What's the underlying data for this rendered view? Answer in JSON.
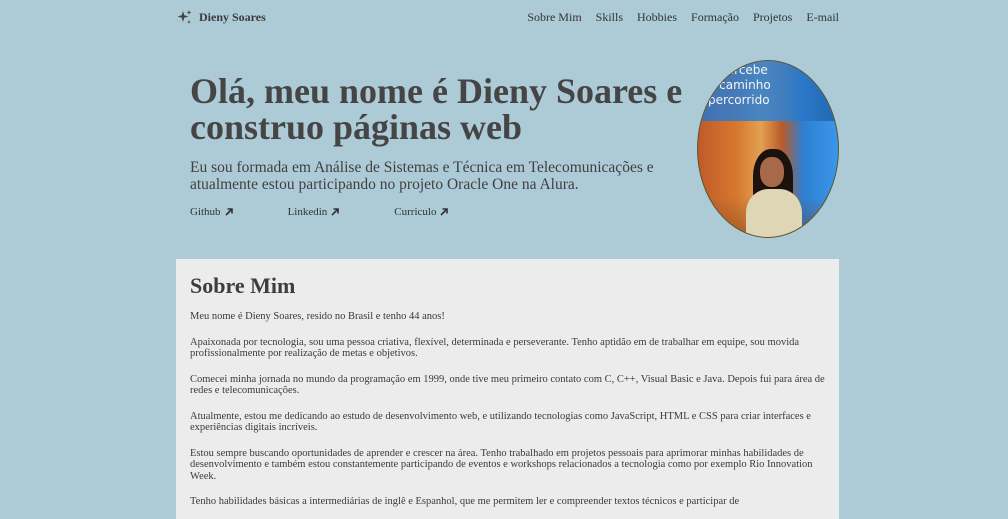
{
  "nav": {
    "brand": "Dieny Soares",
    "brand_icon": "sparkle-icon",
    "items": [
      {
        "label": "Sobre Mim"
      },
      {
        "label": "Skills"
      },
      {
        "label": "Hobbies"
      },
      {
        "label": "Formação"
      },
      {
        "label": "Projetos"
      },
      {
        "label": "E-mail"
      }
    ]
  },
  "hero": {
    "title_line1": "Olá, meu nome é Dieny Soares e",
    "title_line2": "construo páginas web",
    "description": "Eu sou formada em Análise de Sistemas e Técnica em Telecomunicações e atualmente estou participando no projeto Oracle One na Alura.",
    "links": [
      {
        "label": "Github"
      },
      {
        "label": "Linkedin"
      },
      {
        "label": "Curriculo"
      }
    ],
    "photo_sign": [
      "o percebe",
      "o caminho",
      "percorrido"
    ]
  },
  "about": {
    "title": "Sobre Mim",
    "paragraphs": [
      "Meu nome é Dieny Soares, resido no Brasil e tenho 44 anos!",
      "Apaixonada por tecnologia, sou uma pessoa criativa, flexível, determinada e perseverante. Tenho aptidão em de trabalhar em equipe, sou movida profissionalmente por realização de metas e objetivos.",
      "Comecei minha jornada no mundo da programação em 1999, onde tive meu primeiro contato com C, C++, Visual Basic e Java. Depois fui para área de redes e telecomunicações.",
      "Atualmente, estou me dedicando ao estudo de desenvolvimento web, e utilizando tecnologias como JavaScript, HTML e CSS para criar interfaces e experiências digitais incríveis.",
      "Estou sempre buscando oportunidades de aprender e crescer na área. Tenho trabalhado em projetos pessoais para aprimorar minhas habilidades de desenvolvimento e também estou constantemente participando de eventos e workshops relacionados a tecnologia como por exemplo Rio Innovation Week.",
      "Tenho habilidades básicas a intermediárias de inglê e Espanhol, que me permitem ler e compreender textos técnicos e participar de"
    ]
  },
  "colors": {
    "page_background": "#adcbd6",
    "section_background": "#ececec",
    "text": "#464646"
  }
}
